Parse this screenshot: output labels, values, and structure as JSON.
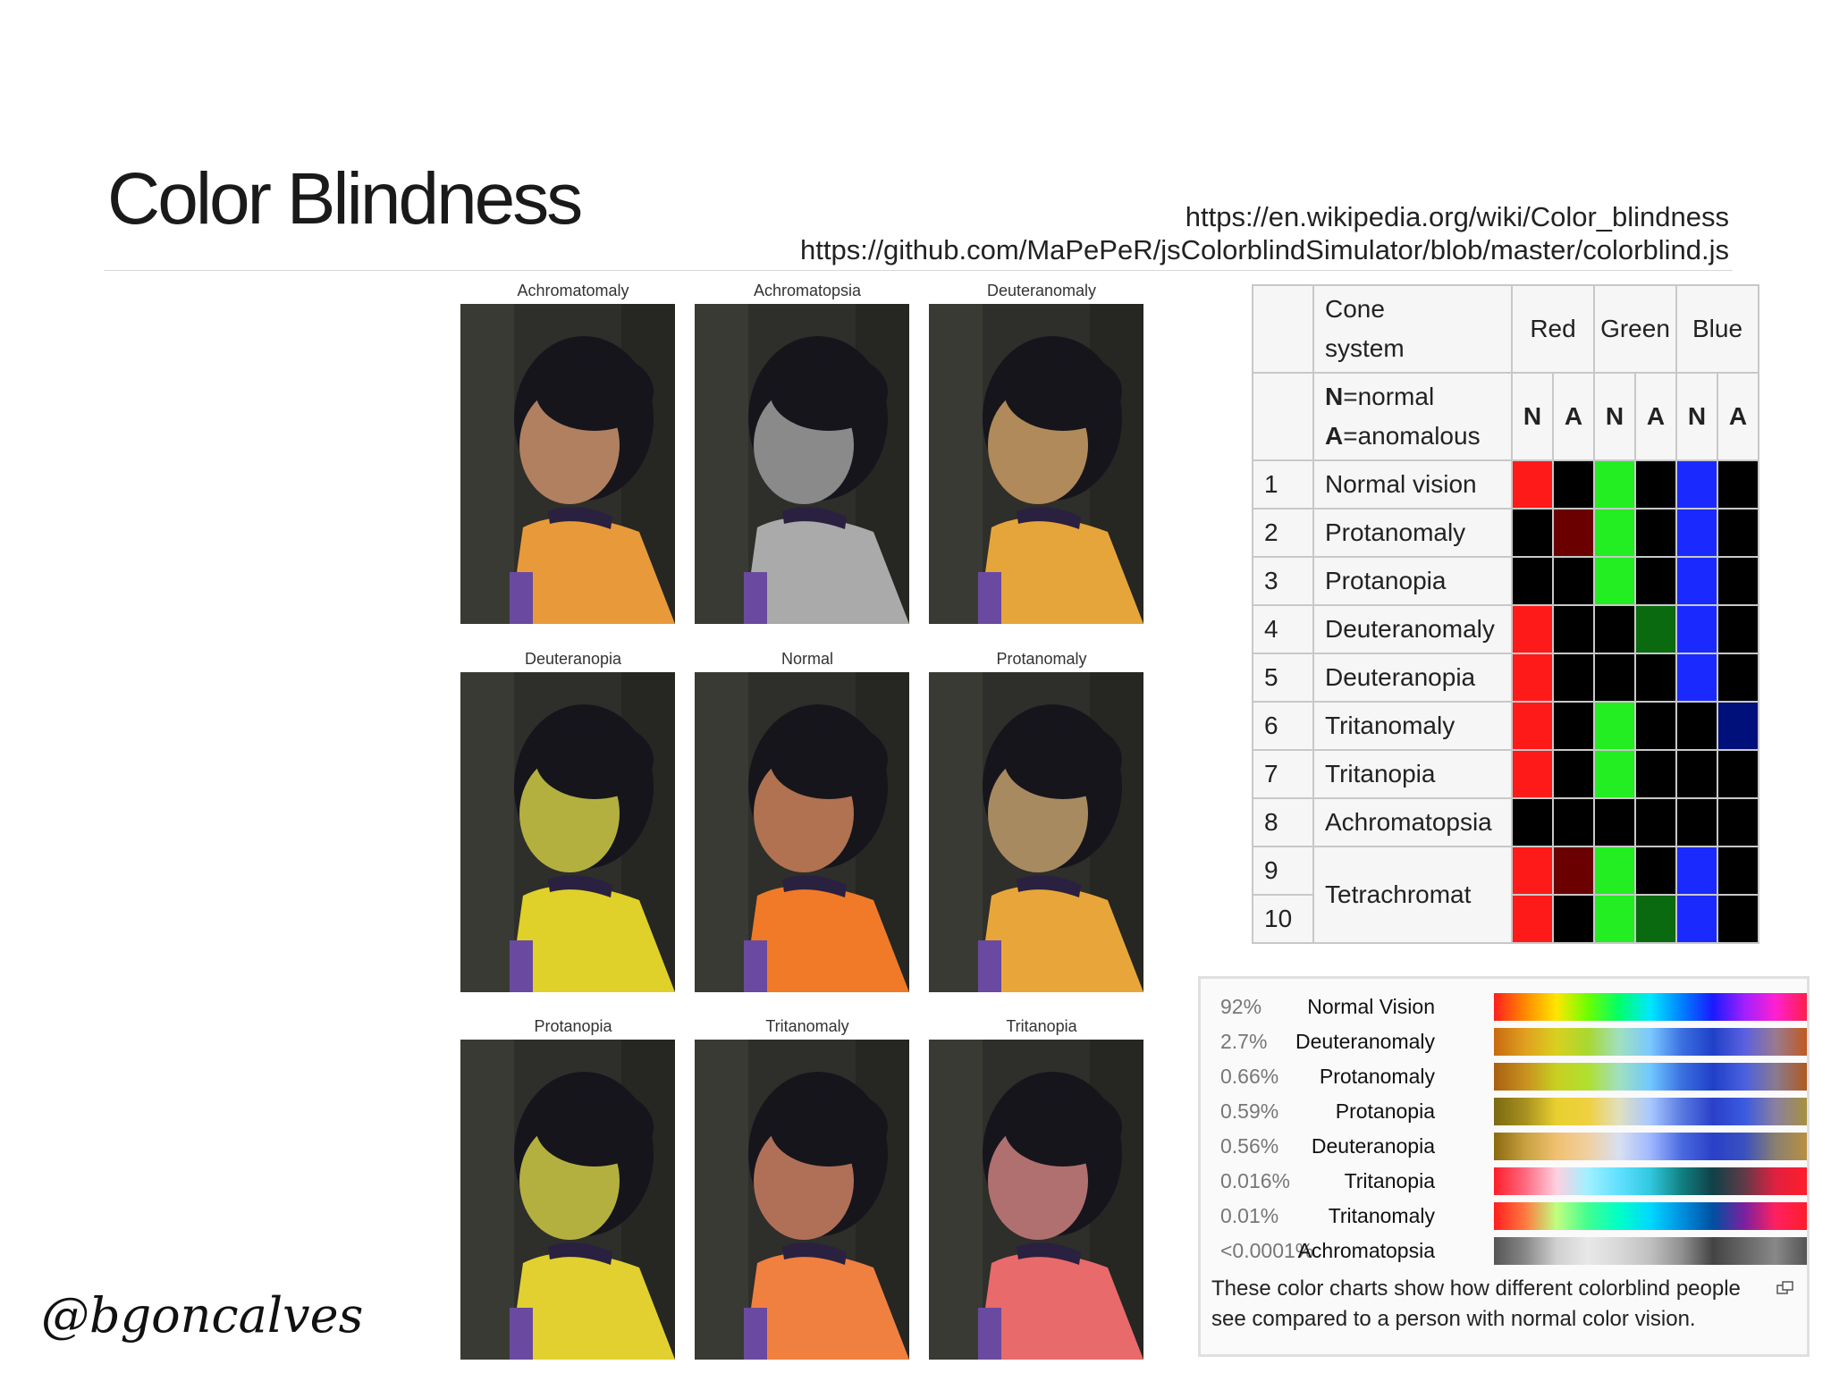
{
  "slide": {
    "title": "Color Blindness",
    "link1": "https://en.wikipedia.org/wiki/Color_blindness",
    "link2": "https://github.com/MaPePeR/jsColorblindSimulator/blob/master/colorblind.js",
    "handle": "@bgoncalves"
  },
  "photos": [
    {
      "caption": "Achromatomaly",
      "shirt": "#e89a3a",
      "face": "#b08060"
    },
    {
      "caption": "Achromatopsia",
      "shirt": "#aaaaaa",
      "face": "#8a8a8a"
    },
    {
      "caption": "Deuteranomaly",
      "shirt": "#e6a53a",
      "face": "#b08a5a"
    },
    {
      "caption": "Deuteranopia",
      "shirt": "#e0d02a",
      "face": "#b4b040"
    },
    {
      "caption": "Normal",
      "shirt": "#f07a28",
      "face": "#b07250"
    },
    {
      "caption": "Protanomaly",
      "shirt": "#e8a63a",
      "face": "#a88a60"
    },
    {
      "caption": "Protanopia",
      "shirt": "#e2d030",
      "face": "#b4b040"
    },
    {
      "caption": "Tritanomaly",
      "shirt": "#f08040",
      "face": "#b07058"
    },
    {
      "caption": "Tritanopia",
      "shirt": "#e86a6a",
      "face": "#b07070"
    }
  ],
  "cone_table": {
    "header_cone": "Cone system",
    "header_cone_l1": "Cone",
    "header_cone_l2": "system",
    "header_red": "Red",
    "header_green": "Green",
    "header_blue": "Blue",
    "legend_n_key": "N",
    "legend_n_val": "=normal",
    "legend_a_key": "A",
    "legend_a_val": "=anomalous",
    "sub": [
      "N",
      "A",
      "N",
      "A",
      "N",
      "A"
    ],
    "rows": [
      {
        "num": "1",
        "name": "Normal vision",
        "cells": [
          "#ff1a1a",
          "#000000",
          "#22ee22",
          "#000000",
          "#1a2aff",
          "#000000"
        ]
      },
      {
        "num": "2",
        "name": "Protanomaly",
        "cells": [
          "#000000",
          "#6a0000",
          "#22ee22",
          "#000000",
          "#1a2aff",
          "#000000"
        ]
      },
      {
        "num": "3",
        "name": "Protanopia",
        "cells": [
          "#000000",
          "#000000",
          "#22ee22",
          "#000000",
          "#1a2aff",
          "#000000"
        ]
      },
      {
        "num": "4",
        "name": "Deuteranomaly",
        "cells": [
          "#ff1a1a",
          "#000000",
          "#000000",
          "#0a6a10",
          "#1a2aff",
          "#000000"
        ]
      },
      {
        "num": "5",
        "name": "Deuteranopia",
        "cells": [
          "#ff1a1a",
          "#000000",
          "#000000",
          "#000000",
          "#1a2aff",
          "#000000"
        ]
      },
      {
        "num": "6",
        "name": "Tritanomaly",
        "cells": [
          "#ff1a1a",
          "#000000",
          "#22ee22",
          "#000000",
          "#000000",
          "#00107a"
        ]
      },
      {
        "num": "7",
        "name": "Tritanopia",
        "cells": [
          "#ff1a1a",
          "#000000",
          "#22ee22",
          "#000000",
          "#000000",
          "#000000"
        ]
      },
      {
        "num": "8",
        "name": "Achromatopsia",
        "cells": [
          "#000000",
          "#000000",
          "#000000",
          "#000000",
          "#000000",
          "#000000"
        ]
      },
      {
        "num": "9",
        "name": "Tetrachromat",
        "cells": [
          "#ff1a1a",
          "#6a0000",
          "#22ee22",
          "#000000",
          "#1a2aff",
          "#000000"
        ]
      },
      {
        "num": "10",
        "name": "",
        "cells": [
          "#ff1a1a",
          "#000000",
          "#22ee22",
          "#0a6a10",
          "#1a2aff",
          "#000000"
        ]
      }
    ]
  },
  "spectrum": {
    "rows": [
      {
        "pct": "92%",
        "name": "Normal Vision",
        "colors": [
          "#ff1e1e",
          "#ff8a00",
          "#ffe600",
          "#6cff00",
          "#00ff6a",
          "#00e8ff",
          "#0080ff",
          "#1a1aff",
          "#a020ff",
          "#ff20d0",
          "#ff1e4a"
        ]
      },
      {
        "pct": "2.7%",
        "name": "Deuteranomaly",
        "colors": [
          "#c86a10",
          "#e0a020",
          "#d8d020",
          "#a8d830",
          "#a0e0c0",
          "#7ac8ff",
          "#3a70e0",
          "#2040c8",
          "#5a60e0",
          "#9a7a90",
          "#c05a20"
        ]
      },
      {
        "pct": "0.66%",
        "name": "Protanomaly",
        "colors": [
          "#a86010",
          "#c89020",
          "#c8d020",
          "#b0e030",
          "#a0e0c0",
          "#70c8ff",
          "#3a70e0",
          "#2040c8",
          "#4a60e0",
          "#8a7a90",
          "#b05a20"
        ]
      },
      {
        "pct": "0.59%",
        "name": "Protanopia",
        "colors": [
          "#7a6a10",
          "#a89020",
          "#e8d030",
          "#f0d040",
          "#e0e0c0",
          "#a8c8ff",
          "#5a7ae0",
          "#2a40c8",
          "#3a5ae0",
          "#8a80a0",
          "#a89040"
        ]
      },
      {
        "pct": "0.56%",
        "name": "Deuteranopia",
        "colors": [
          "#8a6a10",
          "#c8a040",
          "#f0c070",
          "#f0d0a0",
          "#d8e0f0",
          "#a0b8ff",
          "#4a6ae0",
          "#2a40c8",
          "#3a50c0",
          "#8a8070",
          "#b89040"
        ]
      },
      {
        "pct": "0.016%",
        "name": "Tritanopia",
        "colors": [
          "#ff1e2a",
          "#ff6a80",
          "#ffd0e0",
          "#a0f0ff",
          "#60e0ff",
          "#30c8e0",
          "#108080",
          "#104048",
          "#603a48",
          "#e02040",
          "#ff1e2a"
        ]
      },
      {
        "pct": "0.01%",
        "name": "Tritanomaly",
        "colors": [
          "#ff1e1e",
          "#ff7a40",
          "#c0ff80",
          "#40ff90",
          "#00ffc8",
          "#00d8ff",
          "#0090e0",
          "#0050a0",
          "#7a20a0",
          "#ff2060",
          "#ff1e2a"
        ]
      },
      {
        "pct": "<0.0001%",
        "name": "Achromatopsia",
        "colors": [
          "#555555",
          "#888888",
          "#d0d0d0",
          "#e8e8e8",
          "#d8d8d8",
          "#c0c0c0",
          "#909090",
          "#444444",
          "#666666",
          "#888888",
          "#555555"
        ]
      }
    ],
    "caption": "These color charts show how different colorblind people see compared to a person with normal color vision."
  }
}
